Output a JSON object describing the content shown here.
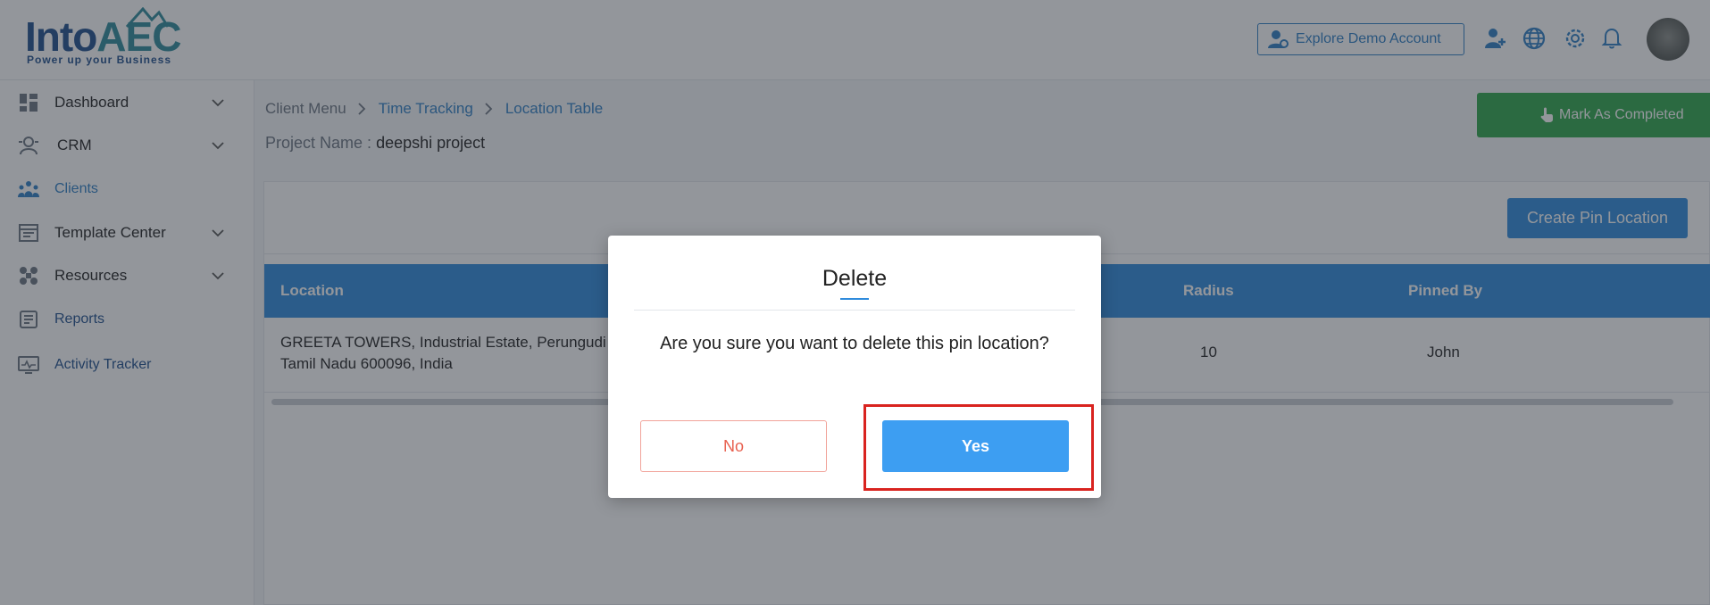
{
  "brand": {
    "name": "IntoAEC",
    "name_into": "Into",
    "name_aec": "AEC",
    "tagline": "Power up your Business",
    "color": "#1f4e8c"
  },
  "header": {
    "demo_button": "Explore Demo Account",
    "icons": [
      "add-user-icon",
      "globe-icon",
      "gear-icon",
      "bell-icon"
    ],
    "accent": "#2f7fc4"
  },
  "sidebar": {
    "items": [
      {
        "label": "Dashboard",
        "icon": "dashboard-icon",
        "expandable": true
      },
      {
        "label": "CRM",
        "icon": "crm-icon",
        "expandable": true
      },
      {
        "label": "Clients",
        "icon": "clients-icon",
        "active": true
      },
      {
        "label": "Template Center",
        "icon": "template-icon",
        "expandable": true
      },
      {
        "label": "Resources",
        "icon": "resources-icon",
        "expandable": true
      },
      {
        "label": "Reports",
        "icon": "reports-icon"
      },
      {
        "label": "Activity Tracker",
        "icon": "activity-icon"
      }
    ]
  },
  "breadcrumb": [
    "Client Menu",
    "Time Tracking",
    "Location Table"
  ],
  "project": {
    "label": "Project Name :",
    "value": "deepshi project"
  },
  "mark_completed": "Mark As Completed",
  "create_pin": "Create Pin Location",
  "table": {
    "headers": {
      "location": "Location",
      "radius": "Radius",
      "pinned_by": "Pinned By"
    },
    "rows": [
      {
        "location_line1": "GREETA TOWERS, Industrial Estate, Perungudi",
        "location_line2": "Tamil Nadu 600096, India",
        "radius": "10",
        "pinned_by": "John"
      }
    ]
  },
  "modal": {
    "title": "Delete",
    "message": "Are you sure you want to delete this pin location?",
    "no": "No",
    "yes": "Yes"
  },
  "colors": {
    "primary": "#2f8bdc",
    "success": "#2ea64a",
    "danger_text": "#e8604f",
    "highlight": "#d9231f"
  }
}
